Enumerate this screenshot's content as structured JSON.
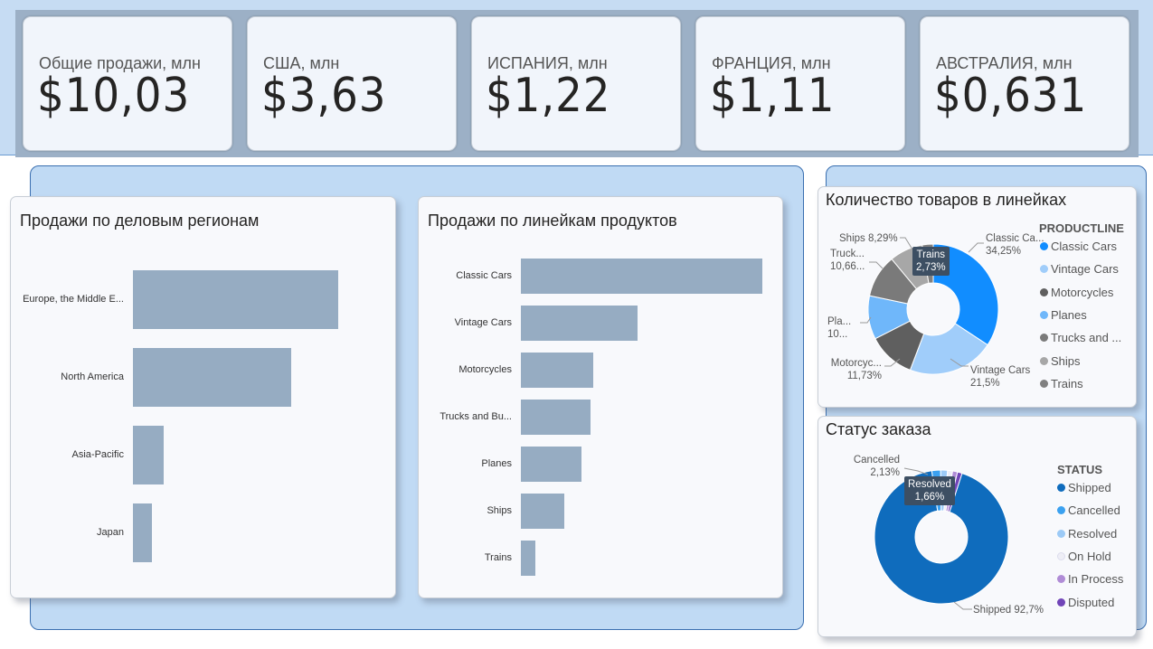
{
  "kpis": [
    {
      "title": "Общие продажи, млн",
      "value": "$10,03"
    },
    {
      "title": "США, млн",
      "value": "$3,63"
    },
    {
      "title": "ИСПАНИЯ, млн",
      "value": "$1,22"
    },
    {
      "title": "ФРАНЦИЯ, млн",
      "value": "$1,11"
    },
    {
      "title": "АВСТРАЛИЯ, млн",
      "value": "$0,631"
    }
  ],
  "colors": {
    "bar": "#96acc2",
    "kpi_band": "#9cb0c6",
    "panel": "#c0daf4"
  },
  "chart_data": [
    {
      "type": "bar",
      "orientation": "horizontal",
      "title": "Продажи по деловым регионам",
      "categories": [
        "Europe, the Middle E...",
        "North America",
        "Asia-Pacific",
        "Japan"
      ],
      "values": [
        4.98,
        3.85,
        0.75,
        0.46
      ],
      "grid": false
    },
    {
      "type": "bar",
      "orientation": "horizontal",
      "title": "Продажи по линейкам продуктов",
      "categories": [
        "Classic Cars",
        "Vintage Cars",
        "Motorcycles",
        "Trucks and Bu...",
        "Planes",
        "Ships",
        "Trains"
      ],
      "values": [
        3.92,
        1.9,
        1.17,
        1.13,
        0.98,
        0.71,
        0.23
      ],
      "grid": false
    },
    {
      "type": "pie",
      "donut": true,
      "title": "Количество товаров в линейках",
      "legend_title": "PRODUCTLINE",
      "legend_position": "right",
      "slices": [
        {
          "name": "Classic Cars",
          "value": 34.25,
          "color": "#118dff"
        },
        {
          "name": "Vintage Cars",
          "value": 21.5,
          "color": "#a0cdfa"
        },
        {
          "name": "Motorcycles",
          "value": 11.73,
          "color": "#5f5f5f"
        },
        {
          "name": "Planes",
          "value": 10.8,
          "color": "#6fb7fa"
        },
        {
          "name": "Trucks and ...",
          "value": 10.66,
          "color": "#7a7a7a"
        },
        {
          "name": "Ships",
          "value": 8.29,
          "color": "#a7a7a7"
        },
        {
          "name": "Trains",
          "value": 2.73,
          "color": "#808080"
        }
      ],
      "data_labels": [
        {
          "line1": "Classic Ca...",
          "line2": "34,25%"
        },
        {
          "line1": "Vintage Cars",
          "line2": "21,5%"
        },
        {
          "line1": "Motorcyc...",
          "line2": "11,73%"
        },
        {
          "line1": "Pla...",
          "line2": "10..."
        },
        {
          "line1": "Truck...",
          "line2": "10,66..."
        },
        {
          "line1": "Ships 8,29%",
          "line2": ""
        }
      ],
      "tooltip": {
        "line1": "Trains",
        "line2": "2,73%"
      }
    },
    {
      "type": "pie",
      "donut": true,
      "title": "Статус заказа",
      "legend_title": "STATUS",
      "legend_position": "right",
      "slices": [
        {
          "name": "Shipped",
          "value": 92.7,
          "color": "#0f6cbd"
        },
        {
          "name": "Cancelled",
          "value": 2.13,
          "color": "#3ba1f0"
        },
        {
          "name": "Resolved",
          "value": 1.66,
          "color": "#9ccaf6"
        },
        {
          "name": "On Hold",
          "value": 1.2,
          "color": "#eeeef6"
        },
        {
          "name": "In Process",
          "value": 1.2,
          "color": "#b08cd6"
        },
        {
          "name": "Disputed",
          "value": 1.11,
          "color": "#7145b8"
        }
      ],
      "data_labels": [
        {
          "line1": "Cancelled",
          "line2": "2,13%"
        },
        {
          "line1": "Shipped 92,7%",
          "line2": ""
        }
      ],
      "tooltip": {
        "line1": "Resolved",
        "line2": "1,66%"
      }
    }
  ]
}
